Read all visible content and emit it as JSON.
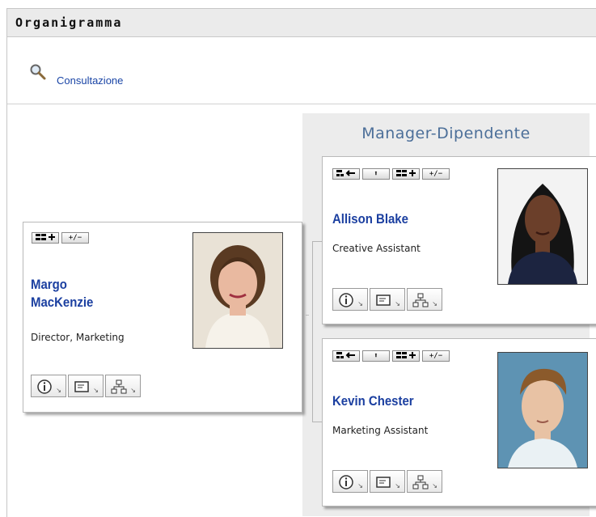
{
  "header": {
    "title": "Organigramma"
  },
  "toolbar": {
    "consult_label": "Consultazione"
  },
  "manager_panel": {
    "title": "Manager-Dipendente"
  },
  "root_person": {
    "first": "Margo",
    "last": "MacKenzie",
    "job_title": "Director, Marketing",
    "tools": [
      "add-icon",
      "expand-collapse-icon"
    ]
  },
  "reports": [
    {
      "name": "Allison Blake",
      "job_title": "Creative Assistant",
      "tools": [
        "hierarchy-back-icon",
        "up-arrow-icon",
        "add-icon",
        "expand-collapse-icon"
      ]
    },
    {
      "name": "Kevin Chester",
      "job_title": "Marketing Assistant",
      "tools": [
        "hierarchy-back-icon",
        "up-arrow-icon",
        "add-icon",
        "expand-collapse-icon"
      ]
    }
  ],
  "tool_glyphs": {
    "plusminus": "+/−",
    "up": "⬆"
  },
  "colors": {
    "name_link": "#1b3fa0",
    "panel_title": "#4c6f99",
    "link": "#1a45a6"
  }
}
